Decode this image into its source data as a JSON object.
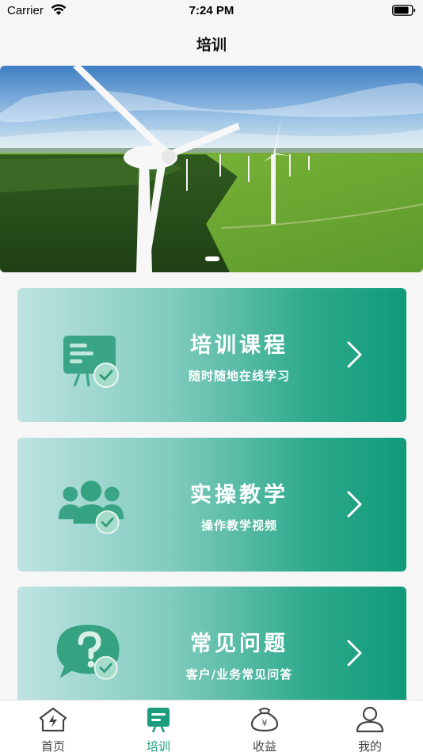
{
  "status_bar": {
    "carrier": "Carrier",
    "time": "7:24 PM"
  },
  "nav": {
    "title": "培训"
  },
  "banner": {
    "description_icon": "wind-turbines-photo",
    "slide_count_indicator": 1
  },
  "cards": [
    {
      "title": "培训课程",
      "subtitle": "随时随地在线学习",
      "icon": "presentation-board-check-icon"
    },
    {
      "title": "实操教学",
      "subtitle": "操作教学视频",
      "icon": "group-users-check-icon"
    },
    {
      "title": "常见问题",
      "subtitle": "客户/业务常见问答",
      "icon": "question-bubble-check-icon"
    }
  ],
  "tab_bar": {
    "items": [
      {
        "label": "首页",
        "icon": "home-icon",
        "active": false
      },
      {
        "label": "培训",
        "icon": "training-board-icon",
        "active": true
      },
      {
        "label": "收益",
        "icon": "money-bag-icon",
        "active": false
      },
      {
        "label": "我的",
        "icon": "profile-icon",
        "active": false
      }
    ]
  },
  "colors": {
    "accent": "#1b9c7c",
    "card_gradient_start": "#bfe3e2",
    "card_gradient_end": "#0f9a7a",
    "background": "#f6f6f6"
  }
}
